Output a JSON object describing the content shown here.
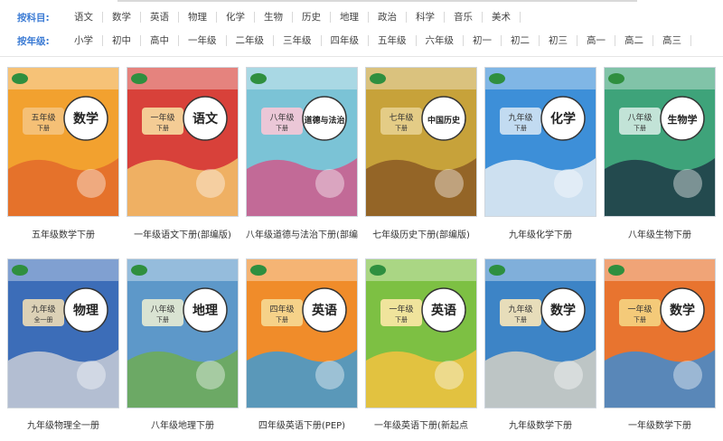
{
  "filters": {
    "subject": {
      "label": "按科目:",
      "options": [
        "语文",
        "数学",
        "英语",
        "物理",
        "化学",
        "生物",
        "历史",
        "地理",
        "政治",
        "科学",
        "音乐",
        "美术"
      ]
    },
    "grade": {
      "label": "按年级:",
      "options": [
        "小学",
        "初中",
        "高中",
        "一年级",
        "二年级",
        "三年级",
        "四年级",
        "五年级",
        "六年级",
        "初一",
        "初二",
        "初三",
        "高一",
        "高二",
        "高三"
      ]
    }
  },
  "books": [
    {
      "title": "五年级数学下册",
      "cover": {
        "subject": "数学",
        "grade": "五年级",
        "term": "下册",
        "bg": "#f2a12f",
        "accent": "#e36a2a",
        "panel": "#f4c27a"
      }
    },
    {
      "title": "一年级语文下册(部编版)",
      "cover": {
        "subject": "语文",
        "grade": "一年级",
        "term": "下册",
        "bg": "#d8413a",
        "accent": "#f3c46b",
        "panel": "#f6d49a"
      }
    },
    {
      "title": "八年级道德与法治下册(部编",
      "cover": {
        "subject": "道德与法治",
        "grade": "八年级",
        "term": "下册",
        "bg": "#7bc3d6",
        "accent": "#cf5a8c",
        "panel": "#f1c7d7"
      }
    },
    {
      "title": "七年级历史下册(部编版)",
      "cover": {
        "subject": "中国历史",
        "grade": "七年级",
        "term": "下册",
        "bg": "#c7a23a",
        "accent": "#8b5a24",
        "panel": "#e6cf8a"
      }
    },
    {
      "title": "九年级化学下册",
      "cover": {
        "subject": "化学",
        "grade": "九年级",
        "term": "下册",
        "bg": "#3d8fd8",
        "accent": "#e6eef4",
        "panel": "#c9dff2"
      }
    },
    {
      "title": "八年级生物下册",
      "cover": {
        "subject": "生物学",
        "grade": "八年级",
        "term": "下册",
        "bg": "#3ea37a",
        "accent": "#1e3b46",
        "panel": "#c9e7dc"
      }
    },
    {
      "title": "九年级物理全一册",
      "cover": {
        "subject": "物理",
        "grade": "九年级",
        "term": "全一册",
        "bg": "#3c6db8",
        "accent": "#c8cdd6",
        "panel": "#e5d7b5"
      }
    },
    {
      "title": "八年级地理下册",
      "cover": {
        "subject": "地理",
        "grade": "八年级",
        "term": "下册",
        "bg": "#5d98c9",
        "accent": "#6fab54",
        "panel": "#dfe7d3"
      }
    },
    {
      "title": "四年级英语下册(PEP)",
      "cover": {
        "subject": "英语",
        "grade": "四年级",
        "term": "下册",
        "bg": "#f08c2a",
        "accent": "#3f9ad2",
        "panel": "#f6d68e"
      }
    },
    {
      "title": "一年级英语下册(新起点",
      "cover": {
        "subject": "英语",
        "grade": "一年级",
        "term": "下册",
        "bg": "#7dc043",
        "accent": "#f3c23f",
        "panel": "#f7e6a1"
      }
    },
    {
      "title": "九年级数学下册",
      "cover": {
        "subject": "数学",
        "grade": "九年级",
        "term": "下册",
        "bg": "#3d84c6",
        "accent": "#d4d0c4",
        "panel": "#f0e2b9"
      }
    },
    {
      "title": "一年级数学下册",
      "cover": {
        "subject": "数学",
        "grade": "一年级",
        "term": "下册",
        "bg": "#e8742f",
        "accent": "#3f8bd0",
        "panel": "#f4cf7d"
      }
    }
  ]
}
